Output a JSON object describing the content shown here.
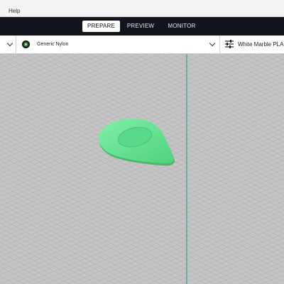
{
  "menubar": {
    "help_label": "Help"
  },
  "stages": {
    "prepare": "PREPARE",
    "preview": "PREVIEW",
    "monitor": "MONITOR",
    "active": "prepare"
  },
  "toolbar": {
    "material_label": "Generic Nylon",
    "material_icon_name": "material-extruder-icon",
    "material_icon_number": "1",
    "material_color": "#2e7d32",
    "print_settings_label": "White Marble PLA... - D"
  },
  "viewport": {
    "background_color": "#c4c4c4",
    "grid_line_color": "#a5a5a5",
    "object_color": "#5fe08d",
    "boundary_line_color": "#3f9c9a"
  }
}
